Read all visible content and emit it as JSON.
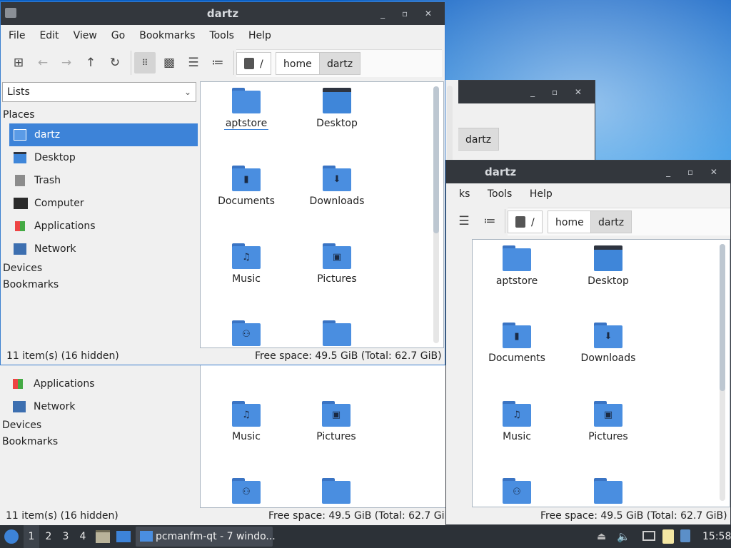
{
  "window_title": "dartz",
  "menu": [
    "File",
    "Edit",
    "View",
    "Go",
    "Bookmarks",
    "Tools",
    "Help"
  ],
  "path": {
    "root": "/",
    "home": "home",
    "current": "dartz"
  },
  "sidebar": {
    "mode": "Lists",
    "places_header": "Places",
    "items": [
      "dartz",
      "Desktop",
      "Trash",
      "Computer",
      "Applications",
      "Network"
    ],
    "devices_header": "Devices",
    "bookmarks_header": "Bookmarks"
  },
  "files": [
    "aptstore",
    "Desktop",
    "Documents",
    "Downloads",
    "Music",
    "Pictures"
  ],
  "status": {
    "items": "11 item(s) (16 hidden)",
    "free": "Free space: 49.5 GiB (Total: 62.7 GiB)"
  },
  "bg_windows": {
    "menu_partial": "ks",
    "tools": "Tools",
    "help": "Help",
    "crumb_dartz": "dartz"
  },
  "taskbar": {
    "workspaces": [
      "1",
      "2",
      "3",
      "4"
    ],
    "task_label": "pcmanfm-qt - 7 windo...",
    "clock": "15:58"
  },
  "colors": {
    "selection": "#3d83d8",
    "folder": "#4a8ee0",
    "titlebar": "#33373d",
    "panel": "#2c3137"
  }
}
